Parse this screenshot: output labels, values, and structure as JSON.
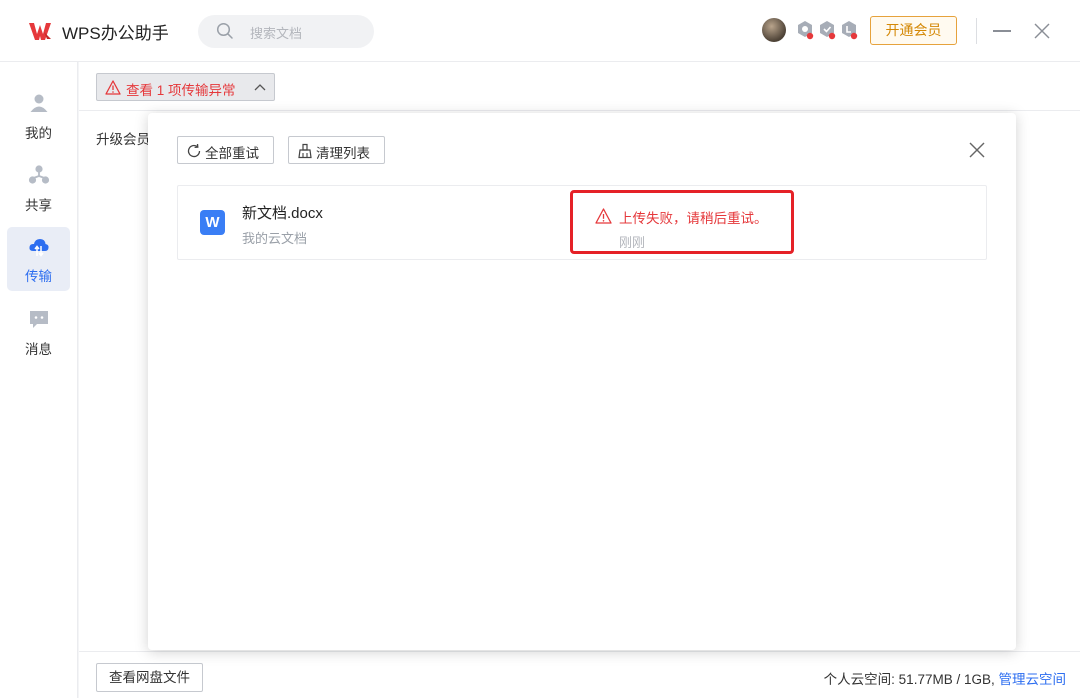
{
  "app": {
    "title": "WPS办公助手",
    "search_placeholder": "搜索文档",
    "vip_button": "开通会员",
    "brand_color": "#e5383b"
  },
  "sidebar": {
    "items": [
      {
        "label": "我的",
        "icon": "user-icon",
        "active": false
      },
      {
        "label": "共享",
        "icon": "share-icon",
        "active": false
      },
      {
        "label": "传输",
        "icon": "cloud-transfer-icon",
        "active": true
      },
      {
        "label": "消息",
        "icon": "message-icon",
        "active": false
      }
    ]
  },
  "main": {
    "warning_toggle": "查看 1 项传输异常",
    "upgrade_text": "升级会员",
    "view_files_button": "查看网盘文件",
    "storage_label": "个人云空间:  51.77MB / 1GB,",
    "manage_link": "管理云空间"
  },
  "panel": {
    "retry_all": "全部重试",
    "clear_list": "清理列表",
    "files": [
      {
        "name": "新文档.docx",
        "location": "我的云文档",
        "type_letter": "W",
        "error": "上传失败，请稍后重试。",
        "time": "刚刚"
      }
    ]
  },
  "colors": {
    "accent_blue": "#2d6ef0",
    "error_red": "#e52127",
    "vip_orange": "#d48806"
  }
}
